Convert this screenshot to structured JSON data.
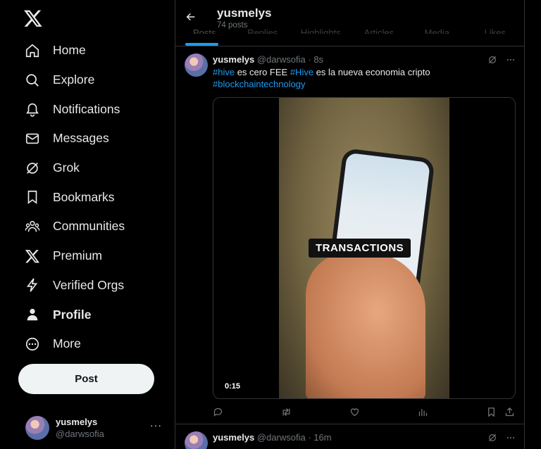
{
  "sidebar": {
    "nav": [
      {
        "label": "Home",
        "icon": "home-icon"
      },
      {
        "label": "Explore",
        "icon": "search-icon"
      },
      {
        "label": "Notifications",
        "icon": "bell-icon"
      },
      {
        "label": "Messages",
        "icon": "envelope-icon"
      },
      {
        "label": "Grok",
        "icon": "grok-icon"
      },
      {
        "label": "Bookmarks",
        "icon": "bookmark-icon"
      },
      {
        "label": "Communities",
        "icon": "communities-icon"
      },
      {
        "label": "Premium",
        "icon": "x-logo-icon"
      },
      {
        "label": "Verified Orgs",
        "icon": "lightning-icon"
      },
      {
        "label": "Profile",
        "icon": "person-icon"
      },
      {
        "label": "More",
        "icon": "more-circle-icon"
      }
    ],
    "post_label": "Post",
    "account": {
      "name": "yusmelys",
      "handle": "@darwsofia",
      "more": "···"
    }
  },
  "header": {
    "title": "yusmelys",
    "subtitle": "74 posts",
    "tabs": [
      "Posts",
      "Replies",
      "Highlights",
      "Articles",
      "Media",
      "Likes"
    ]
  },
  "tweets": [
    {
      "name": "yusmelys",
      "handle": "@darwsofia",
      "dot": "·",
      "time": "8s",
      "text": {
        "h1": "#hive",
        "t1": " es cero FEE ",
        "h2": "#Hive",
        "t2": " es la nueva economia cripto",
        "h3": "#blockchaintechnology"
      },
      "video": {
        "overlay": "TRANSACTIONS",
        "duration": "0:15"
      }
    },
    {
      "name": "yusmelys",
      "handle": "@darwsofia",
      "dot": "·",
      "time": "16m"
    }
  ],
  "colors": {
    "accent": "#1d9bf0",
    "text": "#e7e9ea",
    "muted": "#71767b",
    "border": "#2f3336"
  }
}
